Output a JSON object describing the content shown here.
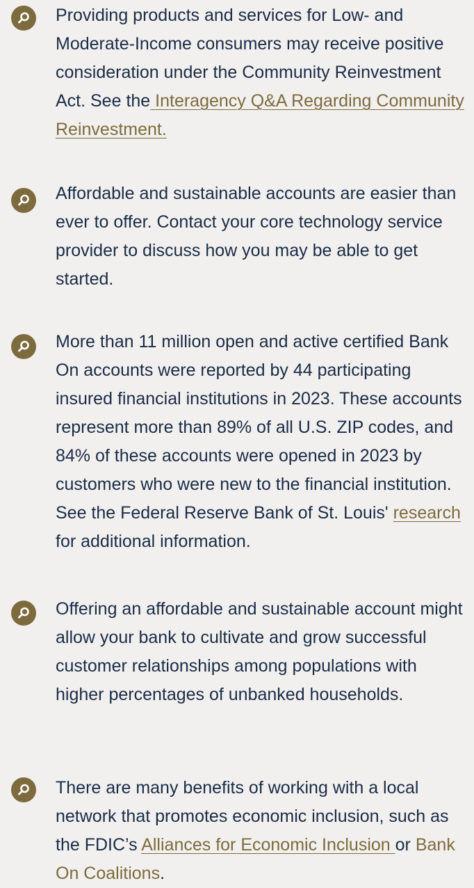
{
  "colors": {
    "background": "#f2f0ee",
    "text": "#1a2c47",
    "accent": "#7d6b3e"
  },
  "bullet_icon": "search-icon",
  "items": [
    {
      "text_before": "Providing products and services for Low- and Moderate-Income consumers may receive positive consideration under the Community Reinvestment Act.  See the",
      "link": " Interagency Q&A Regarding Community Reinvestment.",
      "text_after": ""
    },
    {
      "text": "Affordable and sustainable accounts are easier than ever to offer. Contact your core technology service provider to discuss how you may be able to get started."
    },
    {
      "text_before": "More than 11 million open and active certified Bank On accounts were reported by 44 participating insured financial institutions in 2023. These accounts represent more than 89% of all U.S. ZIP codes, and 84% of these accounts were opened in 2023 by customers who were new to the financial institution. See the Federal Reserve Bank of St. Louis' ",
      "link": "research",
      "text_after": " for additional information."
    },
    {
      "text": "Offering an affordable and sustainable account might allow your bank to cultivate and grow successful customer relationships among populations with higher percentages of unbanked households."
    },
    {
      "text_before": "There are many benefits of working with a local network that promotes economic inclusion, such as the FDIC’s ",
      "link": "Alliances for Economic Inclusion ",
      "text_middle": "or ",
      "link2": "Bank On Coalitions",
      "text_after": "."
    }
  ]
}
